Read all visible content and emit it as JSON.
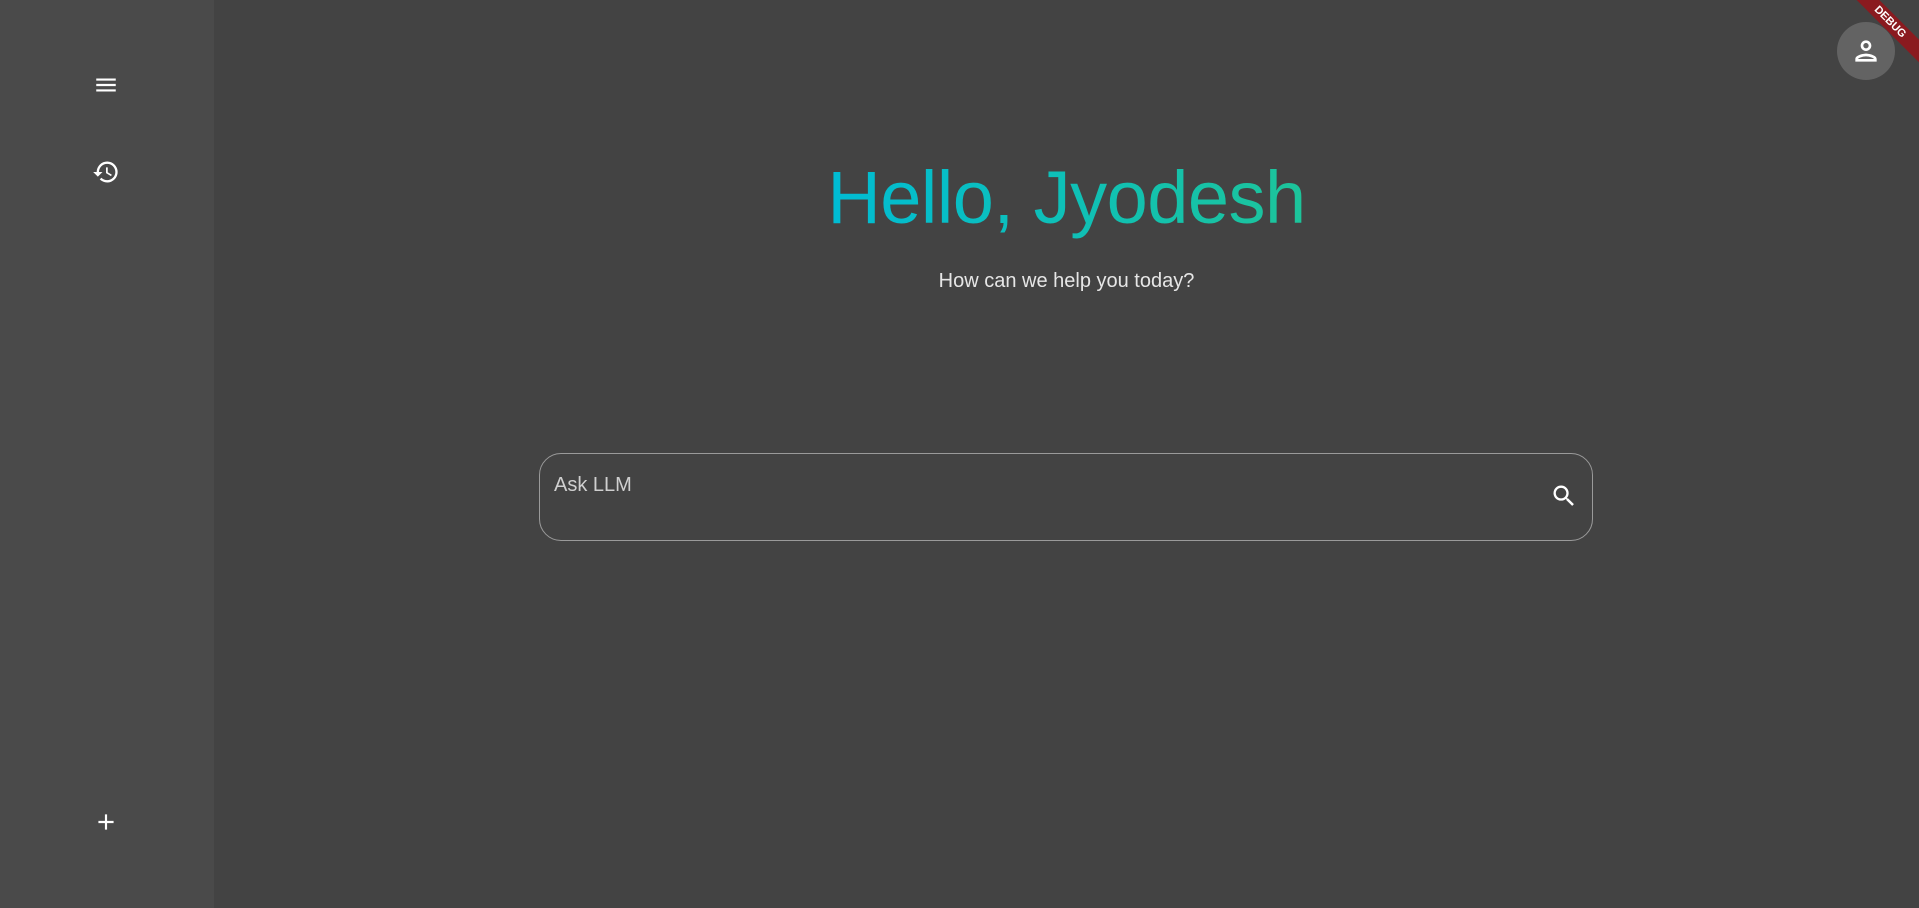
{
  "sidebar": {
    "menu_icon": "menu-icon",
    "history_icon": "history-icon",
    "add_icon": "add-icon"
  },
  "main": {
    "greeting": "Hello, Jyodesh",
    "subtitle": "How can we help you today?",
    "search": {
      "placeholder": "Ask LLM",
      "value": "",
      "icon": "search-icon"
    }
  },
  "profile": {
    "icon": "person-icon"
  },
  "debug_banner": {
    "label": "DEBUG"
  },
  "colors": {
    "background": "#434343",
    "sidebar": "#4a4a4a",
    "greeting_gradient_start": "#00bcd4",
    "greeting_gradient_end": "#1dc49a",
    "avatar_bg": "#636363",
    "debug_ribbon": "#8a1a1f"
  }
}
